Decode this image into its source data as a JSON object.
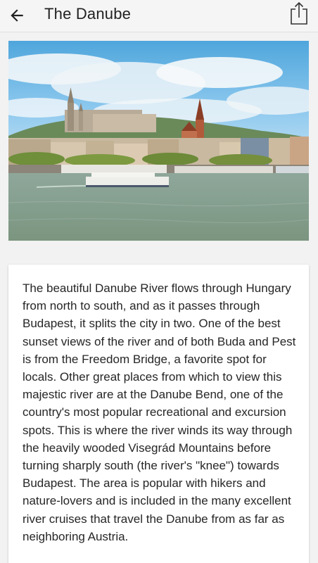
{
  "header": {
    "title": "The Danube",
    "back_icon": "arrow-left-icon",
    "share_icon": "share-icon"
  },
  "hero": {
    "description": "photo"
  },
  "article": {
    "text": "The beautiful Danube River flows through Hungary from north to south, and as it passes through Budapest, it splits the city in two. One of the best sunset views of the river and of both Buda and Pest is from the Freedom Bridge, a favorite spot for locals. Other great places from which to view this majestic river are at the Danube Bend, one of the country's most popular recreational and excursion spots. This is where the river winds its way through the heavily wooded Visegrád Mountains before turning sharply south (the river's \"knee\") towards Budapest. The area is popular with hikers and nature-lovers and is included in the many excellent river cruises that travel the Danube from as far as neighboring Austria."
  },
  "colors": {
    "appbar": "#f5f5f5",
    "background": "#f2f2f2",
    "card": "#ffffff",
    "text": "#262626"
  }
}
